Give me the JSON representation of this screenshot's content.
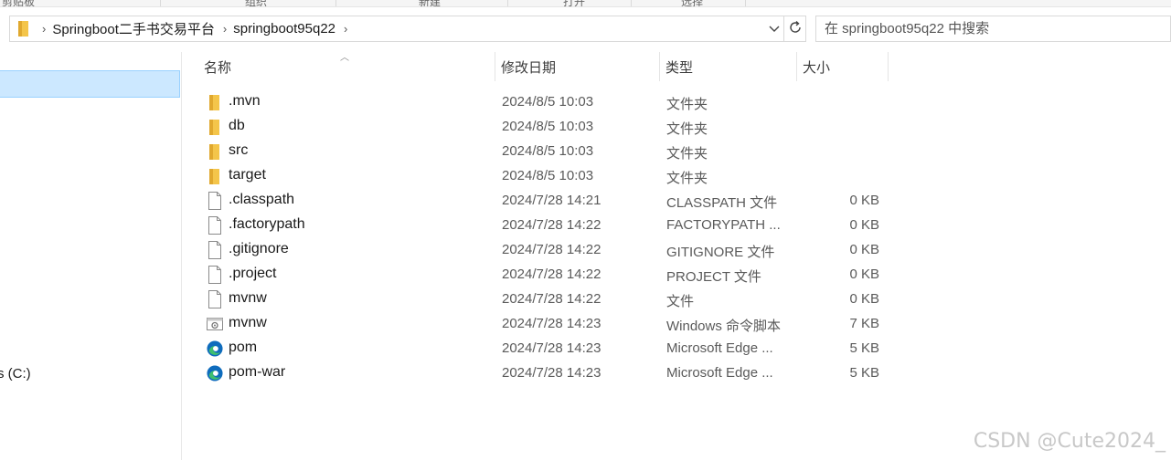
{
  "ribbon": {
    "groups": [
      "剪贴板",
      "组织",
      "新建",
      "打开",
      "选择"
    ]
  },
  "address": {
    "folder_icon": "folder-icon",
    "crumbs": [
      "Springboot二手书交易平台",
      "springboot95q22"
    ],
    "separator": "›"
  },
  "search": {
    "placeholder": "在 springboot95q22 中搜索"
  },
  "nav": {
    "drive_label": "s (C:)"
  },
  "columns": {
    "name": "名称",
    "date": "修改日期",
    "type": "类型",
    "size": "大小"
  },
  "files": [
    {
      "name": ".mvn",
      "date": "2024/8/5 10:03",
      "type": "文件夹",
      "size": "",
      "icon": "folder-icon"
    },
    {
      "name": "db",
      "date": "2024/8/5 10:03",
      "type": "文件夹",
      "size": "",
      "icon": "folder-icon"
    },
    {
      "name": "src",
      "date": "2024/8/5 10:03",
      "type": "文件夹",
      "size": "",
      "icon": "folder-icon"
    },
    {
      "name": "target",
      "date": "2024/8/5 10:03",
      "type": "文件夹",
      "size": "",
      "icon": "folder-icon"
    },
    {
      "name": ".classpath",
      "date": "2024/7/28 14:21",
      "type": "CLASSPATH 文件",
      "size": "0 KB",
      "icon": "file-icon"
    },
    {
      "name": ".factorypath",
      "date": "2024/7/28 14:22",
      "type": "FACTORYPATH ...",
      "size": "0 KB",
      "icon": "file-icon"
    },
    {
      "name": ".gitignore",
      "date": "2024/7/28 14:22",
      "type": "GITIGNORE 文件",
      "size": "0 KB",
      "icon": "file-icon"
    },
    {
      "name": ".project",
      "date": "2024/7/28 14:22",
      "type": "PROJECT 文件",
      "size": "0 KB",
      "icon": "file-icon"
    },
    {
      "name": "mvnw",
      "date": "2024/7/28 14:22",
      "type": "文件",
      "size": "0 KB",
      "icon": "file-icon"
    },
    {
      "name": "mvnw",
      "date": "2024/7/28 14:23",
      "type": "Windows 命令脚本",
      "size": "7 KB",
      "icon": "script-icon"
    },
    {
      "name": "pom",
      "date": "2024/7/28 14:23",
      "type": "Microsoft Edge ...",
      "size": "5 KB",
      "icon": "edge-icon"
    },
    {
      "name": "pom-war",
      "date": "2024/7/28 14:23",
      "type": "Microsoft Edge ...",
      "size": "5 KB",
      "icon": "edge-icon"
    }
  ],
  "watermark": "CSDN @Cute2024_",
  "colors": {
    "folder": "#f4c54a",
    "selection": "#cce8ff",
    "edge_blue": "#0f6cbd",
    "edge_green": "#3fbf6f"
  }
}
